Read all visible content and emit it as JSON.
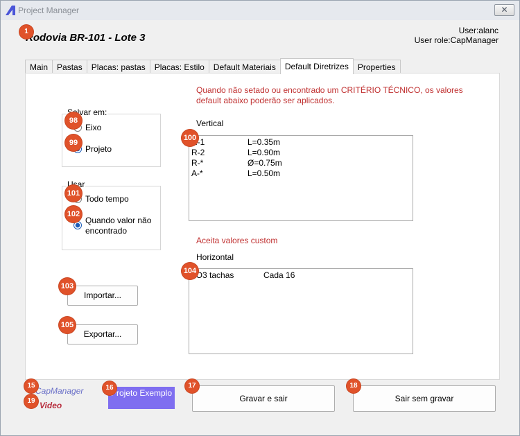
{
  "window": {
    "title": "Project Manager",
    "close_glyph": "✕"
  },
  "header": {
    "project_title": "Rodovia BR-101 - Lote 3",
    "user": "User:alanc",
    "user_role": "User role:CapManager"
  },
  "tabs": [
    {
      "label": "Main"
    },
    {
      "label": "Pastas"
    },
    {
      "label": "Placas: pastas"
    },
    {
      "label": "Placas: Estilo"
    },
    {
      "label": "Default Materiais"
    },
    {
      "label": "Default Diretrizes"
    },
    {
      "label": "Properties"
    }
  ],
  "active_tab": "Default Diretrizes",
  "info_text": "Quando não setado ou encontrado um CRITÉRIO TÉCNICO, os valores default abaixo poderão ser aplicados.",
  "salvar_em": {
    "title": "Salvar em:",
    "options": [
      {
        "label": "Eixo",
        "checked": false
      },
      {
        "label": "Projeto",
        "checked": true
      }
    ]
  },
  "usar": {
    "title": "Usar",
    "options": [
      {
        "label": "Todo tempo",
        "checked": false
      },
      {
        "label": "Quando valor não encontrado",
        "checked": true
      }
    ]
  },
  "vertical": {
    "label": "Vertical",
    "rows": [
      {
        "code": "R-1",
        "value": "L=0.35m"
      },
      {
        "code": "R-2",
        "value": "L=0.90m"
      },
      {
        "code": "R-*",
        "value": "Ø=0.75m"
      },
      {
        "code": "A-*",
        "value": "L=0.50m"
      }
    ]
  },
  "custom_note": "Aceita valores custom",
  "horizontal": {
    "label": "Horizontal",
    "rows": [
      {
        "code": "LO3 tachas",
        "value": "Cada 16"
      }
    ]
  },
  "buttons": {
    "importar": "Importar...",
    "exportar": "Exportar...",
    "projeto_exemplo": "Projeto Exemplo",
    "gravar_e_sair": "Gravar e sair",
    "sair_sem_gravar": "Sair sem gravar"
  },
  "footer": {
    "logo_text": "CapManager",
    "video_text": "Video"
  },
  "badges": [
    "1",
    "98",
    "99",
    "100",
    "101",
    "102",
    "103",
    "104",
    "105",
    "15",
    "16",
    "17",
    "18",
    "19"
  ],
  "colors": {
    "badge": "#e0522a",
    "info_red": "#c03030",
    "project_example_button": "#7f6ef0",
    "radio_checked": "#1c5cb8"
  }
}
